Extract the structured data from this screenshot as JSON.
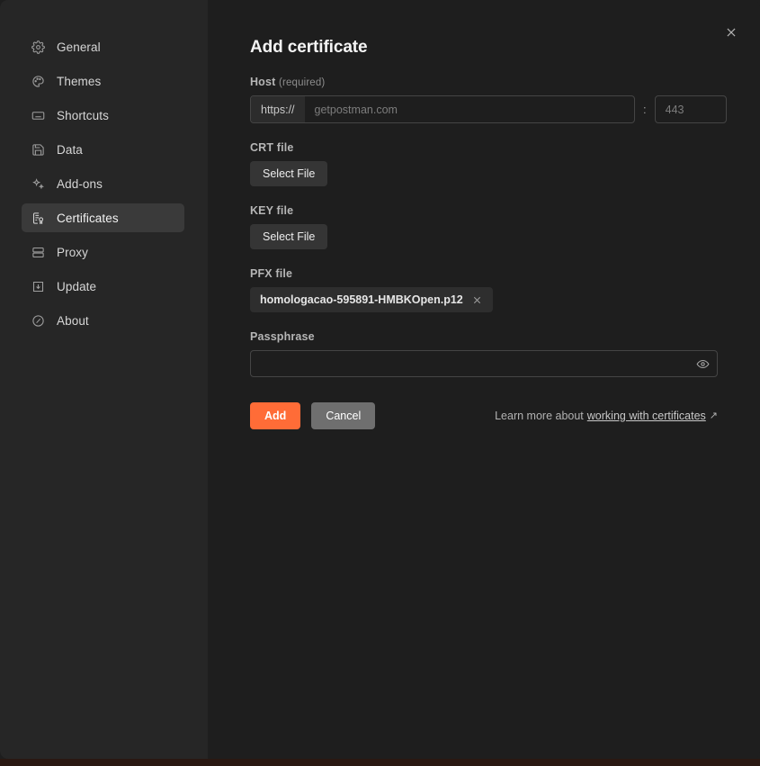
{
  "sidebar": {
    "items": [
      {
        "id": "general",
        "label": "General",
        "icon": "gear-icon",
        "active": false
      },
      {
        "id": "themes",
        "label": "Themes",
        "icon": "palette-icon",
        "active": false
      },
      {
        "id": "shortcuts",
        "label": "Shortcuts",
        "icon": "keyboard-icon",
        "active": false
      },
      {
        "id": "data",
        "label": "Data",
        "icon": "save-disk-icon",
        "active": false
      },
      {
        "id": "add-ons",
        "label": "Add-ons",
        "icon": "sparkles-icon",
        "active": false
      },
      {
        "id": "certificates",
        "label": "Certificates",
        "icon": "certificate-icon",
        "active": true
      },
      {
        "id": "proxy",
        "label": "Proxy",
        "icon": "server-rack-icon",
        "active": false
      },
      {
        "id": "update",
        "label": "Update",
        "icon": "download-box-icon",
        "active": false
      },
      {
        "id": "about",
        "label": "About",
        "icon": "info-circle-icon",
        "active": false
      }
    ]
  },
  "dialog": {
    "title": "Add certificate",
    "close_icon": "close-icon"
  },
  "form": {
    "host": {
      "label": "Host",
      "required_note": "(required)",
      "protocol_prefix": "https://",
      "value": "",
      "placeholder": "getpostman.com",
      "separator": ":",
      "port_value": "",
      "port_placeholder": "443"
    },
    "crt": {
      "label": "CRT file",
      "button_label": "Select File"
    },
    "key": {
      "label": "KEY file",
      "button_label": "Select File"
    },
    "pfx": {
      "label": "PFX file",
      "file_name": "homologacao-595891-HMBKOpen.p12",
      "remove_icon": "close-icon"
    },
    "passphrase": {
      "label": "Passphrase",
      "value": "",
      "placeholder": "",
      "reveal_icon": "eye-icon"
    }
  },
  "actions": {
    "add_label": "Add",
    "cancel_label": "Cancel",
    "learn_more_prefix": "Learn more about",
    "learn_more_link": "working with certificates",
    "external_link_icon": "↗"
  },
  "colors": {
    "accent": "#ff6c37",
    "sidebar_bg": "#262626",
    "main_bg": "#1e1e1e",
    "active_item_bg": "#3a3a3a",
    "cancel_bg": "#6f6f6f",
    "bottom_strip": "#2a1812"
  }
}
